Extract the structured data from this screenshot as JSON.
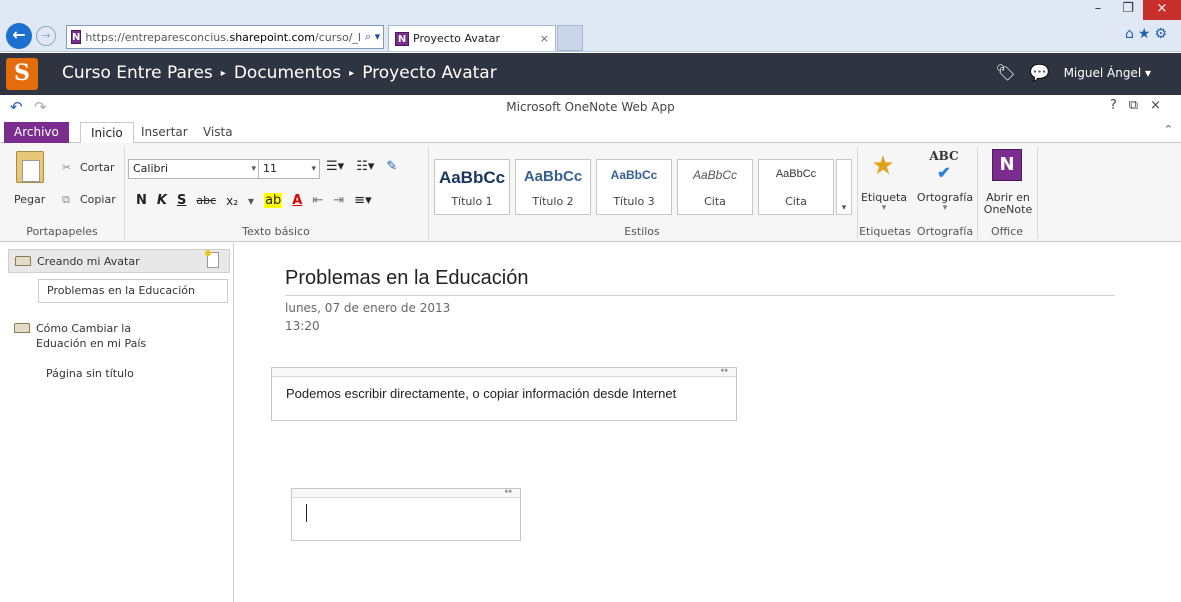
{
  "browser": {
    "url_prefix": "https://entreparesconcius.",
    "url_domain": "sharepoint.com",
    "url_suffix": "/curso/_l",
    "tab_title": "Proyecto Avatar",
    "tab_close": "×",
    "app_badge": "N",
    "win_minimize": "–",
    "win_restore": "❐",
    "win_close": "×",
    "tool_icons": "⌂★⚙"
  },
  "sharepoint": {
    "logo": "S",
    "breadcrumb": [
      "Curso Entre Pares",
      "Documentos",
      "Proyecto Avatar"
    ],
    "separator": "▸",
    "user": "Miguel Ángel ▾"
  },
  "app": {
    "title": "Microsoft OneNote Web App",
    "help": "?",
    "popout": "⧉",
    "close": "×",
    "collapse": "⌃"
  },
  "ribbon_tabs": {
    "archivo": "Archivo",
    "inicio": "Inicio",
    "insertar": "Insertar",
    "vista": "Vista"
  },
  "ribbon": {
    "clipboard": {
      "cut": "Cortar",
      "copy": "Copiar",
      "paste": "Pegar",
      "label": "Portapapeles"
    },
    "basic_text": {
      "font": "Calibri",
      "size": "11",
      "bold": "N",
      "italic": "K",
      "underline": "S",
      "strike": "abc",
      "sub": "x₂",
      "label": "Texto básico"
    },
    "styles": {
      "items": [
        {
          "sample": "AaBbCc",
          "name": "Título 1"
        },
        {
          "sample": "AaBbCc",
          "name": "Título 2"
        },
        {
          "sample": "AaBbCc",
          "name": "Título 3"
        },
        {
          "sample": "AaBbCc",
          "name": "Cita"
        },
        {
          "sample": "AaBbCc",
          "name": "Cita"
        }
      ],
      "label": "Estilos"
    },
    "tags": {
      "button": "Etiqueta",
      "label": "Etiquetas"
    },
    "spelling": {
      "button": "Ortografía",
      "label": "Ortografía",
      "icon_text": "ABC"
    },
    "office": {
      "button_line1": "Abrir en",
      "button_line2": "OneNote",
      "label": "Office"
    }
  },
  "nav": {
    "sections": [
      {
        "name": "Creando mi Avatar",
        "pages": [
          "Problemas en la Educación"
        ]
      },
      {
        "name_line1": "Cómo Cambiar la",
        "name_line2": "Eduación en mi País",
        "pages": [
          "Página sin título"
        ]
      }
    ]
  },
  "page": {
    "title": "Problemas en la Educación",
    "date": "lunes, 07 de enero de 2013",
    "time": "13:20",
    "note_text": "Podemos escribir directamente, o copiar información desde Internet",
    "handle": "↔"
  }
}
